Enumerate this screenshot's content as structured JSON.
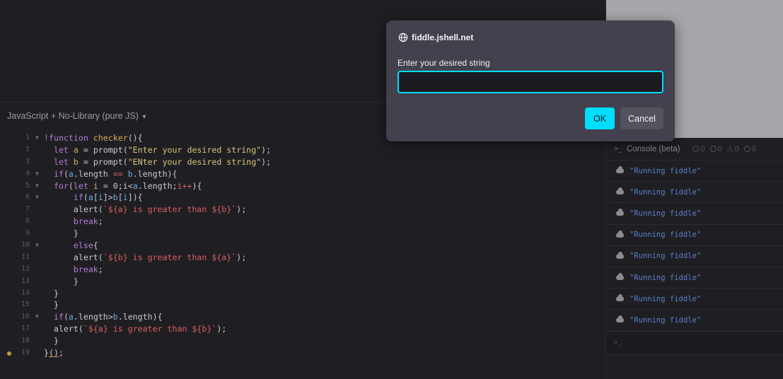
{
  "editor": {
    "language_label": "JavaScript + No-Library (pure JS)",
    "language_caret": "▾",
    "lines": [
      {
        "num": "1",
        "fold": true,
        "html": "<span class=\"kw\">!function</span> <span class=\"fn\">checker</span>(){"
      },
      {
        "num": "2",
        "fold": false,
        "html": "  <span class=\"kw\">let</span> <span class=\"id\">a</span> = prompt(<span class=\"str\">\"Enter your desired string\"</span>);"
      },
      {
        "num": "3",
        "fold": false,
        "html": "  <span class=\"kw\">let</span> <span class=\"id\">b</span> = prompt(<span class=\"str\">\"ENter your desired string\"</span>);"
      },
      {
        "num": "4",
        "fold": true,
        "html": "  <span class=\"kw\">if</span>(<span class=\"prop\">a</span>.length <span class=\"tpl\">==</span> <span class=\"prop\">b</span>.length){"
      },
      {
        "num": "5",
        "fold": true,
        "html": "  <span class=\"kw\">for</span>(<span class=\"kw\">let</span> <span class=\"id\">i</span> = 0;i&lt;<span class=\"prop\">a</span>.length;<span class=\"tpl\">i++</span>){"
      },
      {
        "num": "6",
        "fold": true,
        "html": "      <span class=\"kw\">if</span>(<span class=\"prop\">a</span>[<span class=\"prop\">i</span>]&gt;<span class=\"prop\">b</span>[<span class=\"prop\">i</span>]){"
      },
      {
        "num": "7",
        "fold": false,
        "html": "      alert(<span class=\"tpl\">`${a} is greater than ${b}`</span>);"
      },
      {
        "num": "8",
        "fold": false,
        "html": "      <span class=\"kw\">break</span>;"
      },
      {
        "num": "9",
        "fold": false,
        "html": "      }"
      },
      {
        "num": "10",
        "fold": true,
        "html": "      <span class=\"kw\">else</span>{"
      },
      {
        "num": "11",
        "fold": false,
        "html": "      alert(<span class=\"tpl\">`${b} is greater than ${a}`</span>);"
      },
      {
        "num": "12",
        "fold": false,
        "html": "      <span class=\"kw\">break</span>;"
      },
      {
        "num": "13",
        "fold": false,
        "html": "      }"
      },
      {
        "num": "14",
        "fold": false,
        "html": "  }"
      },
      {
        "num": "15",
        "fold": false,
        "html": "  }"
      },
      {
        "num": "16",
        "fold": true,
        "html": "  <span class=\"kw\">if</span>(<span class=\"prop\">a</span>.length&gt;<span class=\"prop\">b</span>.length){"
      },
      {
        "num": "17",
        "fold": false,
        "html": "  alert(<span class=\"tpl\">`${a} is greater than ${b}`</span>);"
      },
      {
        "num": "18",
        "fold": false,
        "html": "  }"
      },
      {
        "num": "19",
        "fold": false,
        "html": "}<span class=\"ul\">()</span>;"
      }
    ]
  },
  "console": {
    "title": "Console (beta)",
    "counters": [
      "0",
      "0",
      "0",
      "0"
    ],
    "logs": [
      "\"Running fiddle\"",
      "\"Running fiddle\"",
      "\"Running fiddle\"",
      "\"Running fiddle\"",
      "\"Running fiddle\"",
      "\"Running fiddle\"",
      "\"Running fiddle\"",
      "\"Running fiddle\""
    ],
    "prompt_symbol": ">_"
  },
  "dialog": {
    "origin": "fiddle.jshell.net",
    "message": "Enter your desired string",
    "input_value": "",
    "ok_label": "OK",
    "cancel_label": "Cancel"
  },
  "colors": {
    "accent": "#00ddff",
    "dialog_bg": "#42414d",
    "preview_bg": "#a7a7ab"
  }
}
